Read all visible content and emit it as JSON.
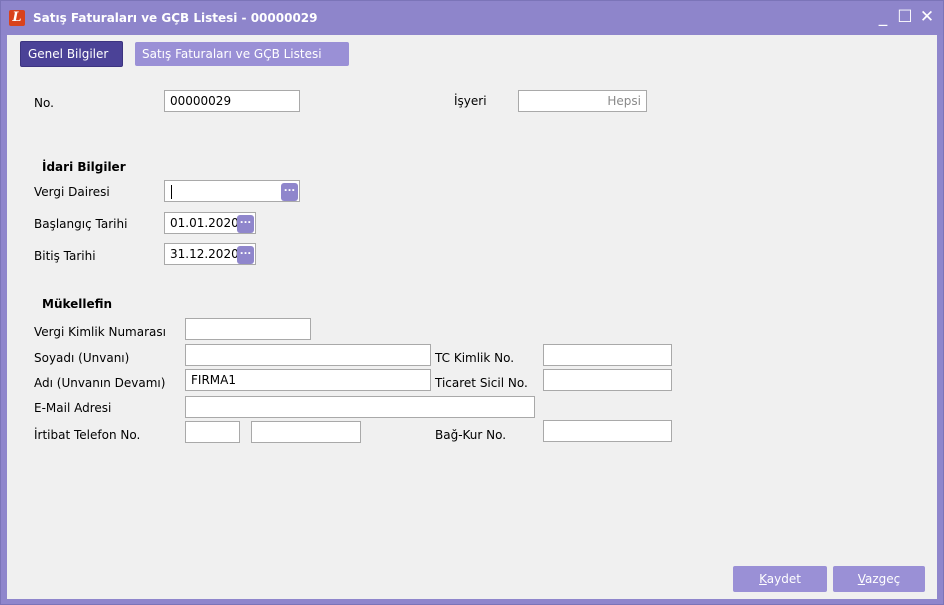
{
  "window": {
    "title": "Satış Faturaları ve GÇB Listesi - 00000029",
    "logo_letter": "L"
  },
  "window_controls": {
    "minimize": "_",
    "maximize": "☐",
    "close": "✕"
  },
  "tabs": [
    {
      "label": "Genel Bilgiler",
      "active": true
    },
    {
      "label": "Satış Faturaları ve GÇB Listesi",
      "active": false
    }
  ],
  "header": {
    "no_label": "No.",
    "no_value": "00000029",
    "isyeri_label": "İşyeri",
    "isyeri_value": "Hepsi"
  },
  "idari": {
    "section_title": "İdari Bilgiler",
    "vergi_dairesi_label": "Vergi Dairesi",
    "vergi_dairesi_value": "",
    "baslangic_label": "Başlangıç Tarihi",
    "baslangic_value": "01.01.2020",
    "bitis_label": "Bitiş Tarihi",
    "bitis_value": "31.12.2020",
    "ellipsis": "..."
  },
  "mukellef": {
    "section_title": "Mükellefin",
    "vkn_label": "Vergi Kimlik Numarası",
    "vkn_value": "",
    "soyadi_label": "Soyadı (Unvanı)",
    "soyadi_value": "",
    "adi_label": "Adı (Unvanın Devamı)",
    "adi_value": "FIRMA1",
    "email_label": "E-Mail Adresi",
    "email_value": "",
    "telefon_label": "İrtibat Telefon No.",
    "telefon_code": "",
    "telefon_number": "",
    "tc_label": "TC Kimlik No.",
    "tc_value": "",
    "ticaret_label": "Ticaret Sicil No.",
    "ticaret_value": "",
    "bagkur_label": "Bağ-Kur No.",
    "bagkur_value": ""
  },
  "buttons": {
    "save_hotkey": "K",
    "save_rest": "aydet",
    "cancel_hotkey": "V",
    "cancel_rest": "azgeç"
  }
}
